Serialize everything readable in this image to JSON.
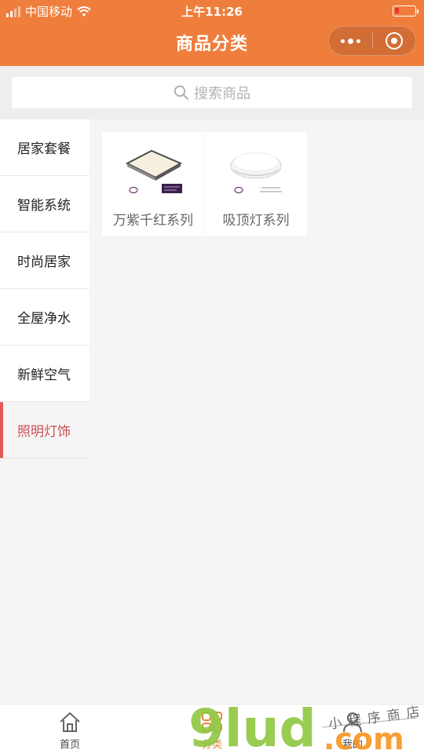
{
  "status_bar": {
    "carrier": "中国移动",
    "time": "上午11:26",
    "battery_level_fraction": 0.15
  },
  "nav": {
    "title": "商品分类",
    "more_icon": "more-dots-icon",
    "close_icon": "circle-target-icon"
  },
  "search": {
    "placeholder": "搜索商品"
  },
  "sidebar": {
    "items": [
      {
        "label": "居家套餐",
        "active": false
      },
      {
        "label": "智能系统",
        "active": false
      },
      {
        "label": "时尚居家",
        "active": false
      },
      {
        "label": "全屋净水",
        "active": false
      },
      {
        "label": "新鲜空气",
        "active": false
      },
      {
        "label": "照明灯饰",
        "active": true
      }
    ]
  },
  "products": [
    {
      "name": "万紫千红系列",
      "icon": "square-ceiling-lamp-image"
    },
    {
      "name": "吸顶灯系列",
      "icon": "round-ceiling-lamp-image"
    }
  ],
  "tabbar": {
    "tabs": [
      {
        "label": "首页",
        "icon": "home-icon",
        "active": false
      },
      {
        "label": "分类",
        "icon": "grid-icon",
        "active": true
      },
      {
        "label": "我的",
        "icon": "user-icon",
        "active": false
      }
    ]
  },
  "watermark": {
    "text_main": "9lud",
    "text_suffix": ".com",
    "text_handwritten": "小程序商店"
  },
  "colors": {
    "brand": "#ef7e3d",
    "active_category": "#d24c53",
    "watermark_green": "#8dc63f",
    "watermark_orange": "#f7931e"
  }
}
